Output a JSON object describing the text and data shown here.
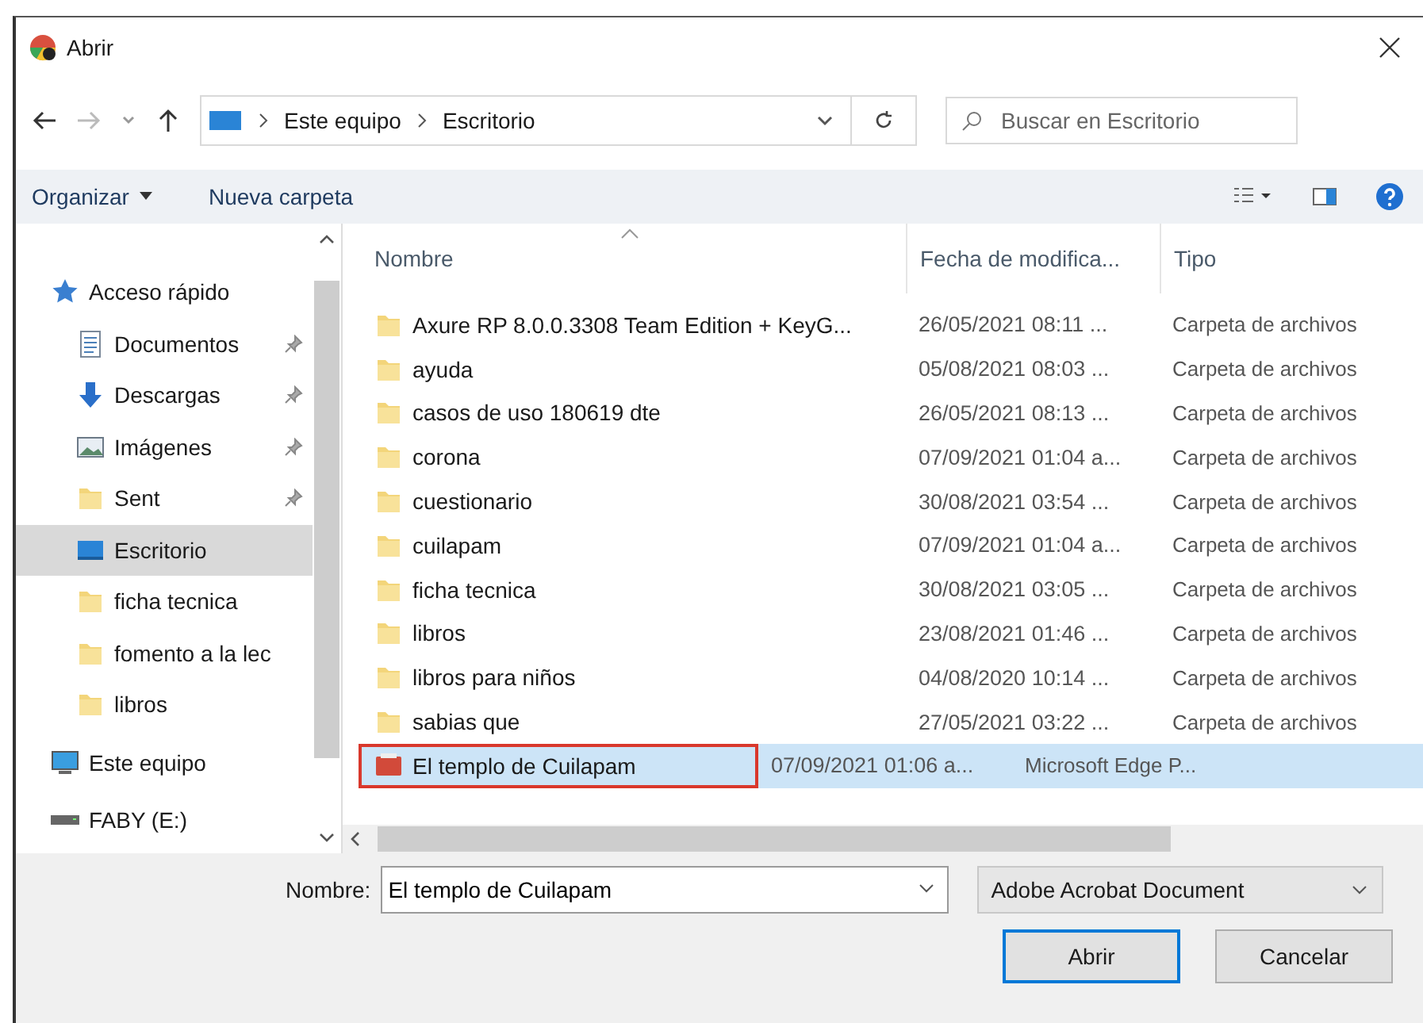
{
  "window": {
    "title": "Abrir"
  },
  "nav": {
    "path": [
      "Este equipo",
      "Escritorio"
    ],
    "search_placeholder": "Buscar en Escritorio"
  },
  "toolbar": {
    "organize": "Organizar",
    "new_folder": "Nueva carpeta"
  },
  "sidebar": {
    "items": [
      {
        "label": "Acceso rápido",
        "kind": "star",
        "pinned": false,
        "selected": false,
        "indent": false
      },
      {
        "label": "Documentos",
        "kind": "document",
        "pinned": true,
        "selected": false,
        "indent": true
      },
      {
        "label": "Descargas",
        "kind": "download",
        "pinned": true,
        "selected": false,
        "indent": true
      },
      {
        "label": "Imágenes",
        "kind": "images",
        "pinned": true,
        "selected": false,
        "indent": true
      },
      {
        "label": "Sent",
        "kind": "folder",
        "pinned": true,
        "selected": false,
        "indent": true
      },
      {
        "label": "Escritorio",
        "kind": "desktop",
        "pinned": false,
        "selected": true,
        "indent": true
      },
      {
        "label": "ficha tecnica",
        "kind": "folder",
        "pinned": false,
        "selected": false,
        "indent": true
      },
      {
        "label": "fomento a la lec",
        "kind": "folder",
        "pinned": false,
        "selected": false,
        "indent": true
      },
      {
        "label": "libros",
        "kind": "folder",
        "pinned": false,
        "selected": false,
        "indent": true
      },
      {
        "label": "Este equipo",
        "kind": "computer",
        "pinned": false,
        "selected": false,
        "indent": false
      },
      {
        "label": "FABY (E:)",
        "kind": "drive",
        "pinned": false,
        "selected": false,
        "indent": false
      }
    ]
  },
  "table": {
    "columns": [
      "Nombre",
      "Fecha de modifica...",
      "Tipo"
    ],
    "rows": [
      {
        "name": "Axure RP 8.0.0.3308 Team Edition + KeyG...",
        "date": "26/05/2021 08:11 ...",
        "type": "Carpeta de archivos",
        "kind": "folder",
        "selected": false,
        "outlined": false
      },
      {
        "name": "ayuda",
        "date": "05/08/2021 08:03 ...",
        "type": "Carpeta de archivos",
        "kind": "folder",
        "selected": false,
        "outlined": false
      },
      {
        "name": "casos de uso 180619 dte",
        "date": "26/05/2021 08:13 ...",
        "type": "Carpeta de archivos",
        "kind": "folder",
        "selected": false,
        "outlined": false
      },
      {
        "name": "corona",
        "date": "07/09/2021 01:04 a...",
        "type": "Carpeta de archivos",
        "kind": "folder",
        "selected": false,
        "outlined": false
      },
      {
        "name": "cuestionario",
        "date": "30/08/2021 03:54 ...",
        "type": "Carpeta de archivos",
        "kind": "folder",
        "selected": false,
        "outlined": false
      },
      {
        "name": "cuilapam",
        "date": "07/09/2021 01:04 a...",
        "type": "Carpeta de archivos",
        "kind": "folder",
        "selected": false,
        "outlined": false
      },
      {
        "name": "ficha tecnica",
        "date": "30/08/2021 03:05 ...",
        "type": "Carpeta de archivos",
        "kind": "folder",
        "selected": false,
        "outlined": false
      },
      {
        "name": "libros",
        "date": "23/08/2021 01:46 ...",
        "type": "Carpeta de archivos",
        "kind": "folder",
        "selected": false,
        "outlined": false
      },
      {
        "name": "libros para niños",
        "date": "04/08/2020 10:14 ...",
        "type": "Carpeta de archivos",
        "kind": "folder",
        "selected": false,
        "outlined": false
      },
      {
        "name": "sabias que",
        "date": "27/05/2021 03:22 ...",
        "type": "Carpeta de archivos",
        "kind": "folder",
        "selected": false,
        "outlined": false
      },
      {
        "name": "El templo de Cuilapam",
        "date": "07/09/2021 01:06 a...",
        "type": "Microsoft Edge P...",
        "kind": "pdf",
        "selected": true,
        "outlined": true
      }
    ]
  },
  "bottom": {
    "name_label": "Nombre:",
    "name_value": "El templo de Cuilapam",
    "file_type": "Adobe Acrobat Document",
    "buttons": [
      "Abrir",
      "Cancelar"
    ]
  }
}
